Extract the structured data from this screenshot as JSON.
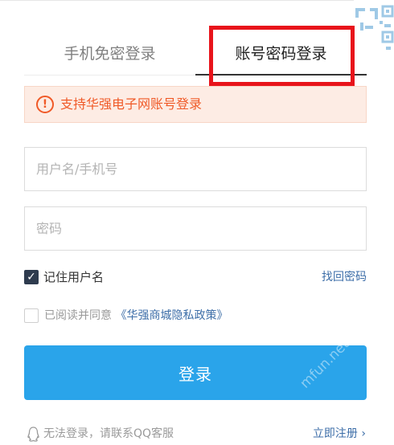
{
  "tabs": {
    "sms_login": "手机免密登录",
    "account_login": "账号密码登录"
  },
  "alert": {
    "icon": "!",
    "text": "支持华强电子网账号登录"
  },
  "fields": {
    "username_placeholder": "用户名/手机号",
    "password_placeholder": "密码"
  },
  "remember": {
    "checked_mark": "✓",
    "label": "记住用户名"
  },
  "forgot_password": "找回密码",
  "agreement": {
    "prefix": "已阅读并同意",
    "link": "《华强商城隐私政策》"
  },
  "login_button": "登录",
  "footer": {
    "help_text": "无法登录，请联系QQ客服",
    "register": "立即注册 ›"
  },
  "watermark": "mfun.net 魔趣网",
  "colors": {
    "accent": "#2aa4ea",
    "alert_text": "#f05a28",
    "alert_bg": "#fdece4",
    "link": "#3d6ea8",
    "highlight": "#e8141b"
  },
  "icons": {
    "alert": "exclamation-circle-icon",
    "remember": "checkbox-checked-icon",
    "agreement": "checkbox-unchecked-icon",
    "help": "qq-penguin-icon",
    "corner": "qr-code-icon"
  }
}
